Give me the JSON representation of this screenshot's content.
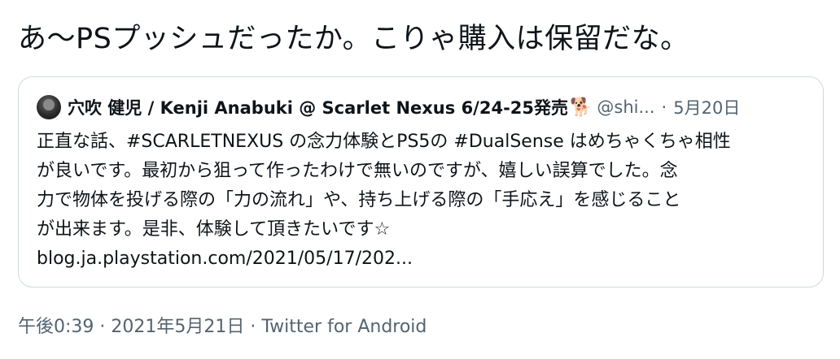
{
  "tweet": {
    "text": "あ〜PSプッシュだったか。こりゃ購入は保留だな。"
  },
  "quote": {
    "display_name": "穴吹 健児 / Kenji Anabuki @ Scarlet Nexus 6/24-25発売",
    "emoji_icon": "dog-emoji-icon",
    "emoji_glyph": "🐕",
    "handle": "@shi...",
    "separator": "·",
    "date": "5月20日",
    "lines": [
      "正直な話、#SCARLETNEXUS の念力体験とPS5の #DualSense はめちゃくちゃ相性",
      "が良いです。最初から狙って作ったわけで無いのですが、嬉しい誤算でした。念",
      "力で物体を投げる際の「力の流れ」や、持ち上げる際の「手応え」を感じること",
      "が出来ます。是非、体験して頂きたいです☆",
      "blog.ja.playstation.com/2021/05/17/202..."
    ]
  },
  "footer": {
    "time": "午後0:39",
    "sep1": " · ",
    "date": "2021年5月21日",
    "sep2": " · ",
    "client": "Twitter for Android"
  }
}
